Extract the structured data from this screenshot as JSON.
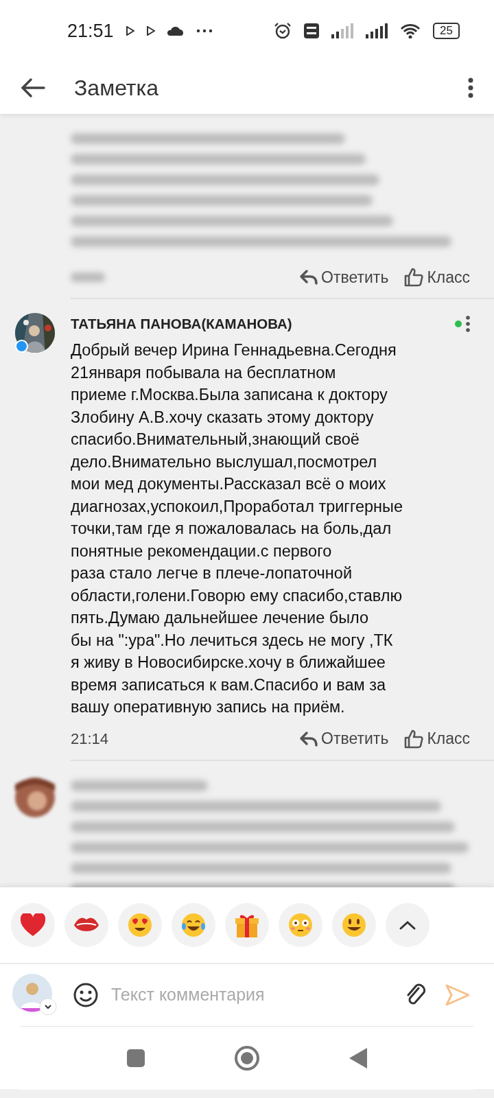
{
  "status_bar": {
    "time": "21:51",
    "battery": "25"
  },
  "header": {
    "title": "Заметка"
  },
  "comments": [
    {
      "kind": "blurred",
      "actions": [
        "Ответить",
        "Класс"
      ]
    },
    {
      "kind": "full",
      "author": "ТАТЬЯНА ПАНОВА(КАМАНОВА)",
      "online": true,
      "text": "Добрый вечер Ирина Геннадьевна.Сегодня\n21января побывала на бесплатном\nприеме г.Москва.Была записана к доктору\nЗлобину А.В.хочу сказать этому доктору\nспасибо.Внимательный,знающий своё\nдело.Внимательно выслушал,посмотрел\nмои мед документы.Рассказал всё о моих\nдиагнозах,успокоил,Проработал триггерные\nточки,там где я пожаловалась на боль,дал\nпонятные рекомендации.с первого\nраза стало легче в плече-лопаточной\nобласти,голени.Говорю ему спасибо,ставлю\nпять.Думаю дальнейшее лечение было\nбы на \":ура\".Но лечиться здесь не могу ,ТК\nя живу в Новосибирске.хочу в ближайшее\nвремя записаться к вам.Спасибо и вам за\nвашу оперативную запись на приём.",
      "time": "21:14",
      "actions": [
        "Ответить",
        "Класс"
      ]
    },
    {
      "kind": "blurred_author"
    }
  ],
  "reactions": [
    {
      "kind": "heart"
    },
    {
      "kind": "lips"
    },
    {
      "kind": "heart_eyes"
    },
    {
      "kind": "tears_joy"
    },
    {
      "kind": "gift"
    },
    {
      "kind": "flushed"
    },
    {
      "kind": "smile"
    },
    {
      "kind": "expand"
    }
  ],
  "composer": {
    "placeholder": "Текст комментария"
  }
}
